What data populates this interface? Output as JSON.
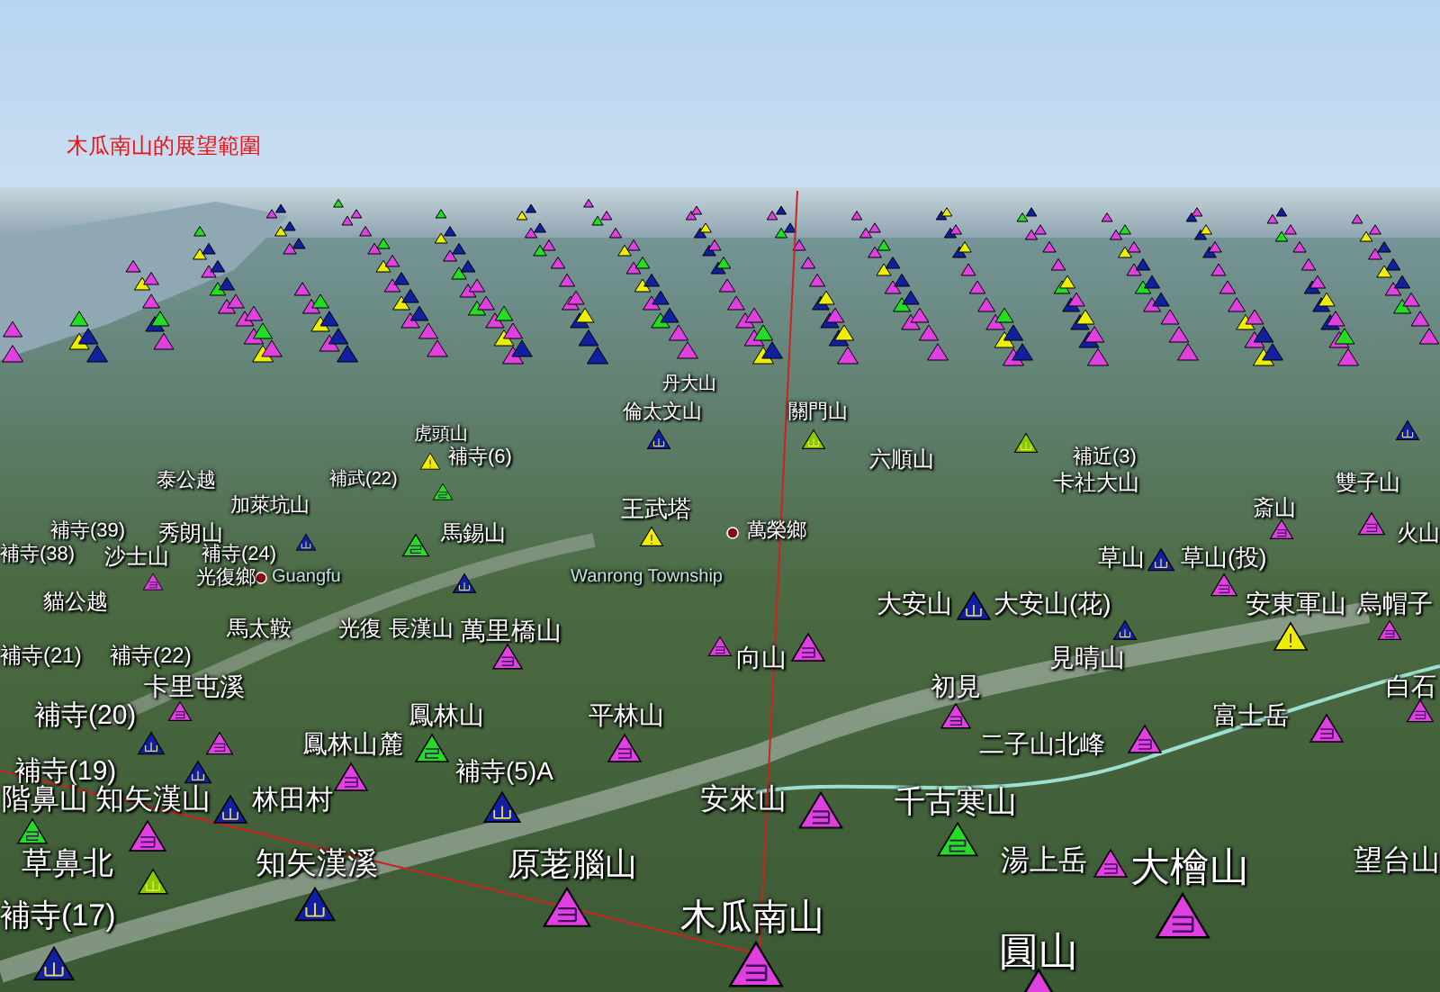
{
  "title": "木瓜南山的展望範圍",
  "labels": [
    {
      "text": "丹大山"
    },
    {
      "text": "倫太文山"
    },
    {
      "text": "關門山"
    },
    {
      "text": "虎頭山"
    },
    {
      "text": "補寺(6)"
    },
    {
      "text": "六順山"
    },
    {
      "text": "補近(3)"
    },
    {
      "text": "泰公越"
    },
    {
      "text": "補武(22)"
    },
    {
      "text": "卡社大山"
    },
    {
      "text": "雙子山"
    },
    {
      "text": "加萊坑山"
    },
    {
      "text": "王武塔"
    },
    {
      "text": "斎山"
    },
    {
      "text": "補寺(39)"
    },
    {
      "text": "秀朗山"
    },
    {
      "text": "馬錫山"
    },
    {
      "text": "萬榮鄉"
    },
    {
      "text": "火山"
    },
    {
      "text": "補寺(38)"
    },
    {
      "text": "沙士山"
    },
    {
      "text": "補寺(24)"
    },
    {
      "text": "草山"
    },
    {
      "text": "草山(投)"
    },
    {
      "text": "光復鄉"
    },
    {
      "text": "Guangfu"
    },
    {
      "text": "Wanrong Township"
    },
    {
      "text": "貓公越"
    },
    {
      "text": "大安山"
    },
    {
      "text": "大安山(花)"
    },
    {
      "text": "安東軍山"
    },
    {
      "text": "烏帽子"
    },
    {
      "text": "馬太鞍"
    },
    {
      "text": "光復"
    },
    {
      "text": "長漢山"
    },
    {
      "text": "萬里橋山"
    },
    {
      "text": "補寺(21)"
    },
    {
      "text": "補寺(22)"
    },
    {
      "text": "向山"
    },
    {
      "text": "見晴山"
    },
    {
      "text": "卡里屯溪"
    },
    {
      "text": "初見"
    },
    {
      "text": "白石"
    },
    {
      "text": "補寺(20)"
    },
    {
      "text": "鳳林山"
    },
    {
      "text": "平林山"
    },
    {
      "text": "富士岳"
    },
    {
      "text": "鳳林山麓"
    },
    {
      "text": "二子山北峰"
    },
    {
      "text": "補寺(19)"
    },
    {
      "text": "補寺(5)A"
    },
    {
      "text": "階鼻山"
    },
    {
      "text": "知矢漢山"
    },
    {
      "text": "林田村"
    },
    {
      "text": "安來山"
    },
    {
      "text": "千古寒山"
    },
    {
      "text": "草鼻北"
    },
    {
      "text": "知矢漢溪"
    },
    {
      "text": "原荖腦山"
    },
    {
      "text": "湯上岳"
    },
    {
      "text": "大檜山"
    },
    {
      "text": "望台山"
    },
    {
      "text": "補寺(17)"
    },
    {
      "text": "木瓜南山"
    },
    {
      "text": "圓山"
    }
  ],
  "markers": [
    {
      "kind": "three",
      "color": "#e040e0"
    },
    {
      "kind": "three",
      "color": "#e040e0"
    },
    {
      "kind": "three",
      "color": "#e040e0"
    },
    {
      "kind": "three",
      "color": "#e040e0"
    },
    {
      "kind": "two",
      "color": "#22dd22"
    },
    {
      "kind": "three",
      "color": "#e040e0"
    },
    {
      "kind": "three",
      "color": "#e040e0"
    },
    {
      "kind": "mountain",
      "color": "#1020a0"
    },
    {
      "kind": "mountain",
      "color": "#1020a0"
    },
    {
      "kind": "three",
      "color": "#e040e0"
    },
    {
      "kind": "two",
      "color": "#22dd22"
    },
    {
      "kind": "mountain",
      "color": "#88cc00"
    },
    {
      "kind": "mountain",
      "color": "#1020a0"
    },
    {
      "kind": "mountain",
      "color": "#1020a0"
    },
    {
      "kind": "mountain",
      "color": "#1020a0"
    },
    {
      "kind": "three",
      "color": "#e040e0"
    },
    {
      "kind": "two",
      "color": "#22dd22"
    },
    {
      "kind": "three",
      "color": "#e040e0"
    },
    {
      "kind": "three",
      "color": "#e040e0"
    },
    {
      "kind": "mountain",
      "color": "#1020a0"
    },
    {
      "kind": "three",
      "color": "#e040e0"
    },
    {
      "kind": "three",
      "color": "#e040e0"
    },
    {
      "kind": "three",
      "color": "#e040e0"
    },
    {
      "kind": "three",
      "color": "#e040e0"
    },
    {
      "kind": "three",
      "color": "#e040e0"
    },
    {
      "kind": "mountain",
      "color": "#1020a0"
    },
    {
      "kind": "mountain",
      "color": "#1020a0"
    },
    {
      "kind": "mountain",
      "color": "#1020a0"
    },
    {
      "kind": "three",
      "color": "#e040e0"
    },
    {
      "kind": "alert",
      "color": "#eeee00"
    },
    {
      "kind": "three",
      "color": "#e040e0"
    },
    {
      "kind": "three",
      "color": "#e040e0"
    },
    {
      "kind": "mountain",
      "color": "#1020a0"
    },
    {
      "kind": "three",
      "color": "#e040e0"
    },
    {
      "kind": "alert",
      "color": "#eeee00"
    },
    {
      "kind": "mountain",
      "color": "#88cc00"
    },
    {
      "kind": "mountain",
      "color": "#88cc00"
    },
    {
      "kind": "mountain",
      "color": "#1020a0"
    },
    {
      "kind": "two",
      "color": "#22dd22"
    },
    {
      "kind": "three",
      "color": "#e040e0"
    },
    {
      "kind": "three",
      "color": "#e040e0"
    },
    {
      "kind": "two",
      "color": "#22dd22"
    },
    {
      "kind": "mountain",
      "color": "#1020a0"
    },
    {
      "kind": "three",
      "color": "#e040e0"
    },
    {
      "kind": "three",
      "color": "#e040e0"
    },
    {
      "kind": "mountain",
      "color": "#1020a0"
    },
    {
      "kind": "alert",
      "color": "#eeee00"
    }
  ]
}
